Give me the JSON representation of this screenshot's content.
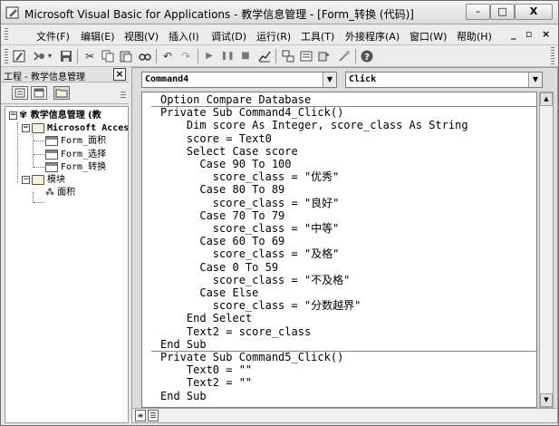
{
  "window": {
    "title": "Microsoft Visual Basic for Applications - 教学信息管理 - [Form_转换 (代码)]",
    "controls": {
      "minimize": "–",
      "maximize": "□",
      "close": "X"
    }
  },
  "menu": {
    "items": [
      "文件(F)",
      "编辑(E)",
      "视图(V)",
      "插入(I)",
      "调试(D)",
      "运行(R)",
      "工具(T)",
      "外接程序(A)",
      "窗口(W)",
      "帮助(H)"
    ],
    "mdi_controls": {
      "minimize": "_",
      "restore": "▫",
      "close": "×"
    }
  },
  "toolbar": {
    "icons": [
      "vb-icon",
      "insert-icon",
      "save-icon",
      "cut-icon",
      "copy-icon",
      "paste-icon",
      "find-icon",
      "undo-icon",
      "redo-icon",
      "run-icon",
      "break-icon",
      "reset-icon",
      "design-mode-icon",
      "project-explorer-icon",
      "properties-icon",
      "object-browser-icon",
      "toolbox-icon",
      "help-icon"
    ]
  },
  "project": {
    "title": "工程 - 教学信息管理",
    "close": "×",
    "root": "教学信息管理 (教",
    "folder_access": "Microsoft Acces",
    "forms": [
      "Form_面积",
      "Form_选择",
      "Form_转换"
    ],
    "folder_modules": "模块",
    "modules": [
      "面积"
    ]
  },
  "code_window": {
    "object_combo": "Command4",
    "procedure_combo": "Click",
    "lines": [
      "Option Compare Database",
      "Private Sub Command4_Click()",
      "    Dim score As Integer, score_class As String",
      "    score = Text0",
      "    Select Case score",
      "      Case 90 To 100",
      "        score_class = \"优秀\"",
      "      Case 80 To 89",
      "        score_class = \"良好\"",
      "      Case 70 To 79",
      "        score_class = \"中等\"",
      "      Case 60 To 69",
      "        score_class = \"及格\"",
      "      Case 0 To 59",
      "        score_class = \"不及格\"",
      "      Case Else",
      "        score_class = \"分数越界\"",
      "    End Select",
      "    Text2 = score_class",
      "End Sub",
      "Private Sub Command5_Click()",
      "    Text0 = \"\"",
      "    Text2 = \"\"",
      "End Sub"
    ]
  }
}
